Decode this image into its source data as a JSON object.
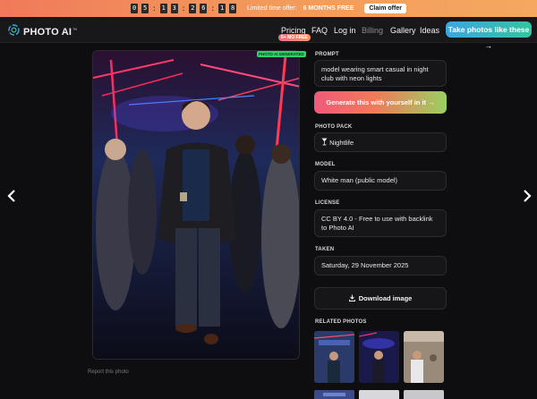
{
  "promo": {
    "countdown": [
      "0",
      "5",
      "1",
      "3",
      "2",
      "6",
      "1",
      "8"
    ],
    "text": "Limited time offer:",
    "highlight": "6 MONTHS FREE",
    "claim_label": "Claim offer"
  },
  "header": {
    "logo_text": "PHOTO AI",
    "logo_tm": "™",
    "nav": {
      "pricing": "Pricing",
      "pricing_badge": "6+ MO FREE",
      "faq": "FAQ",
      "login": "Log in",
      "billing": "Billing",
      "gallery": "Gallery",
      "ideas": "Ideas"
    },
    "cta_label": "Take photos like these →"
  },
  "photo": {
    "badge": "PHOTO AI GENERATED",
    "report_label": "Report this photo"
  },
  "details": {
    "prompt_label": "PROMPT",
    "prompt_value": "model wearing smart casual in night club with neon lights",
    "generate_label": "Generate this with yourself in it →",
    "pack_label": "PHOTO PACK",
    "pack_icon": "cocktail-glass-icon",
    "pack_value": "Nightlife",
    "model_label": "MODEL",
    "model_value": "White man (public model)",
    "license_label": "LICENSE",
    "license_value": "CC BY 4.0 - Free to use with backlink to Photo AI",
    "taken_label": "TAKEN",
    "taken_value": "Saturday, 29 November 2025",
    "download_label": "Download image",
    "related_label": "RELATED PHOTOS"
  },
  "colors": {
    "accent_gradient_start": "#3ca6e0",
    "accent_gradient_end": "#35c4a0",
    "promo_start": "#f07a5a",
    "generate_start": "#f05a7a",
    "generate_end": "#9ad060"
  }
}
